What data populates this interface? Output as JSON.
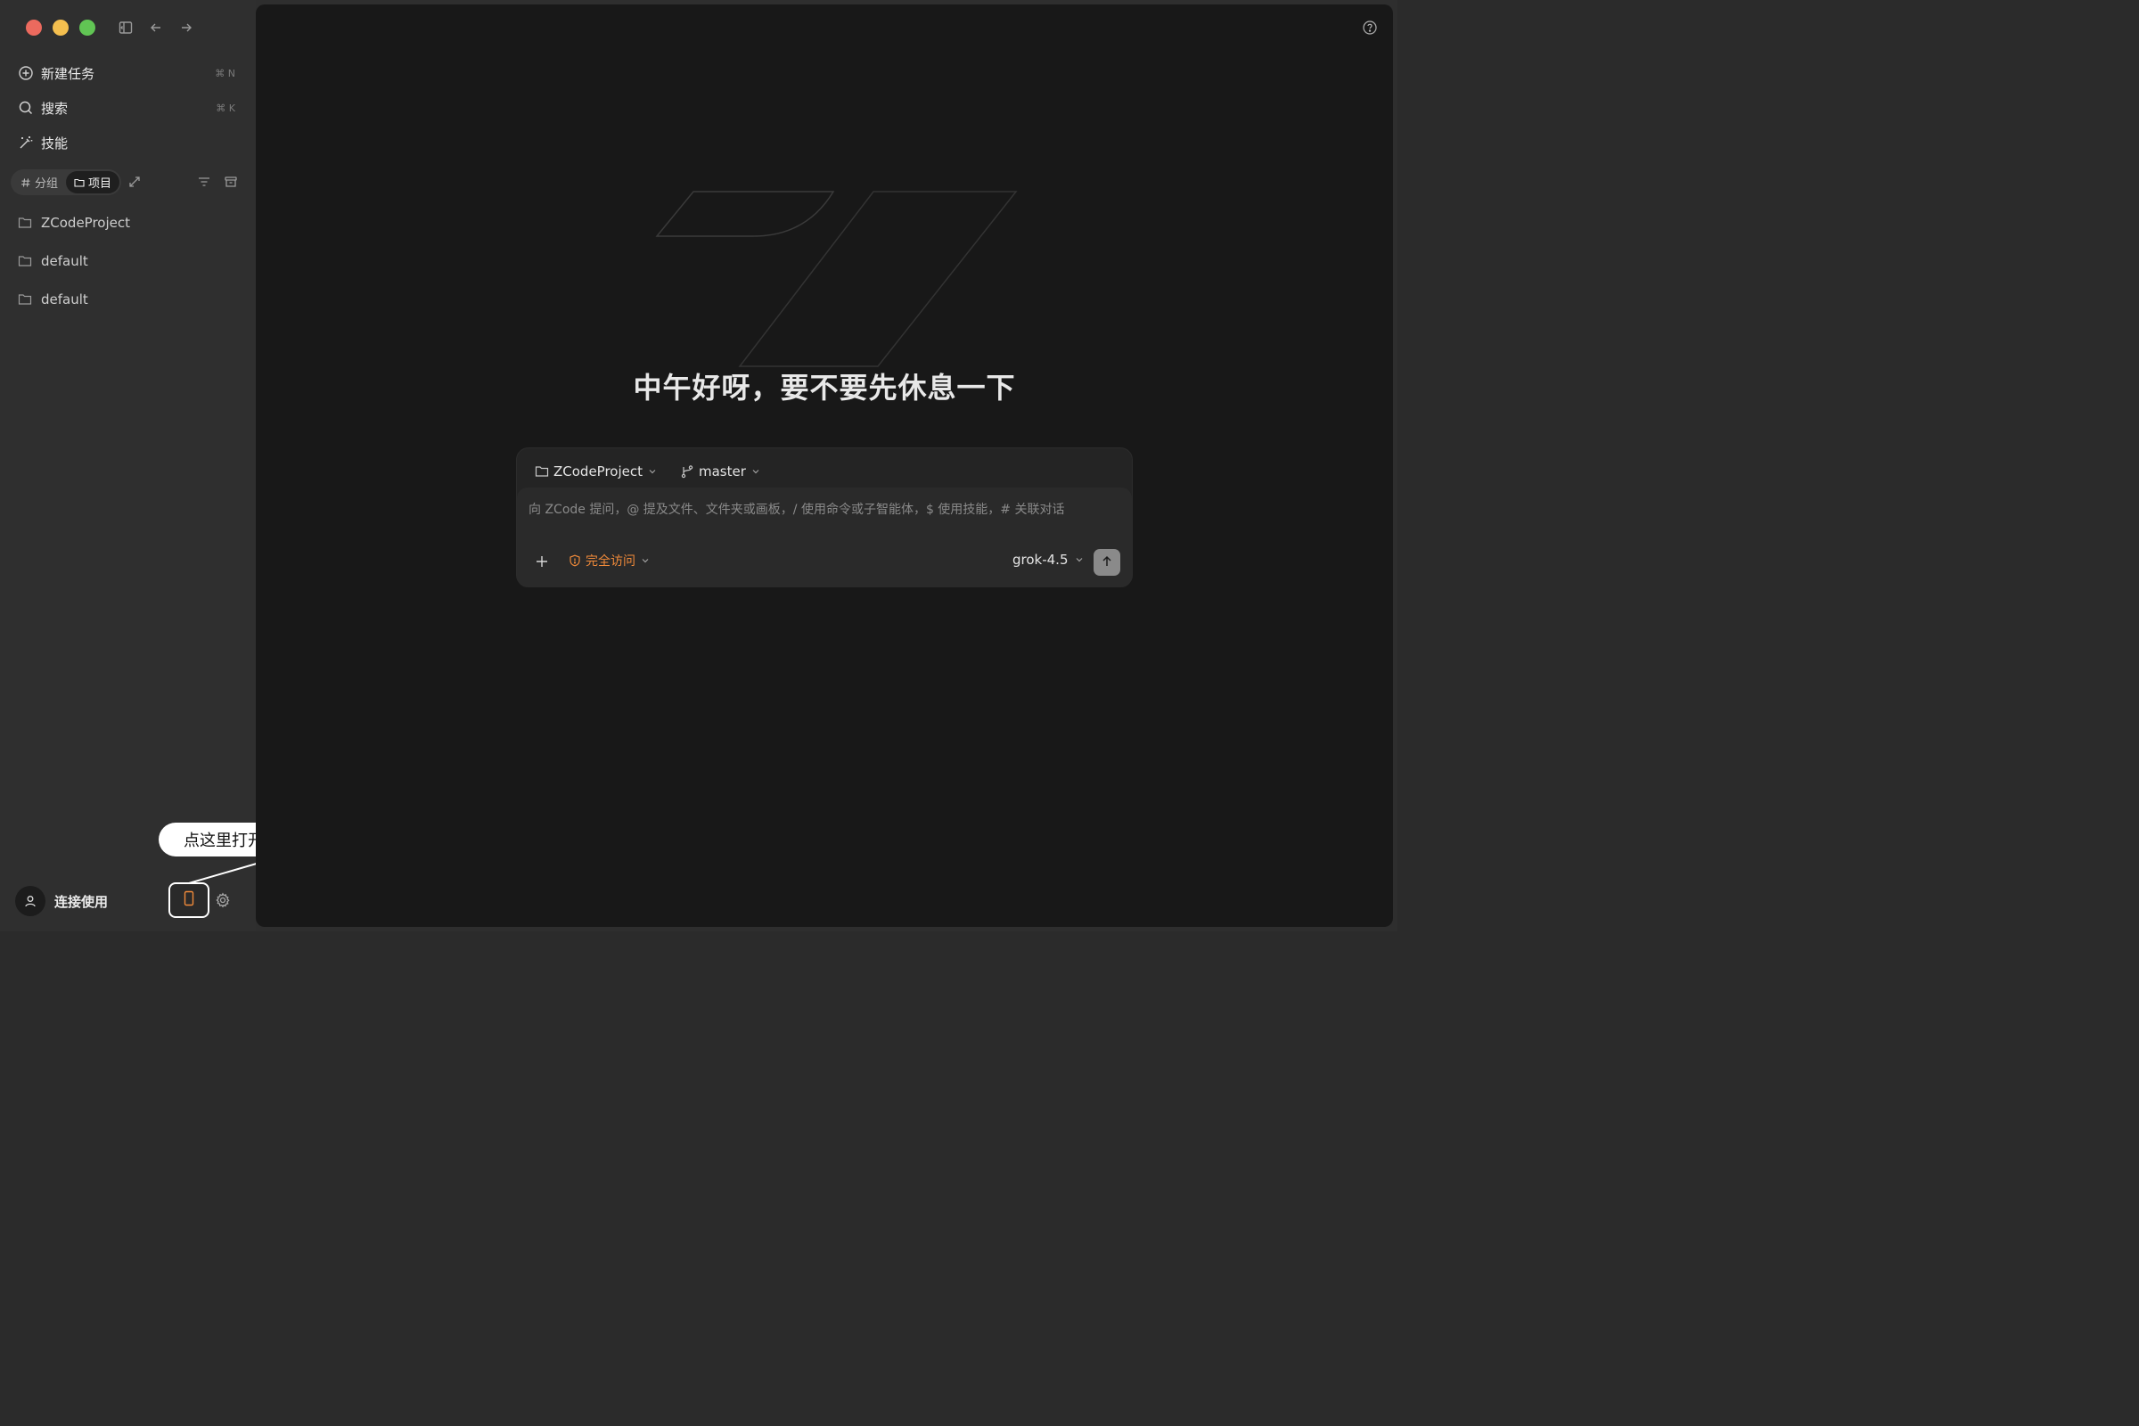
{
  "sidebar": {
    "nav": [
      {
        "label": "新建任务",
        "shortcut": "⌘ N",
        "icon": "plus-circle-icon"
      },
      {
        "label": "搜索",
        "shortcut": "⌘ K",
        "icon": "search-icon"
      },
      {
        "label": "技能",
        "shortcut": "",
        "icon": "magic-wand-icon"
      }
    ],
    "segment": [
      {
        "label": "分组",
        "icon": "hash-icon",
        "active": false
      },
      {
        "label": "项目",
        "icon": "folder-icon",
        "active": true
      }
    ],
    "projects": [
      "ZCodeProject",
      "default",
      "default"
    ],
    "user_label": "连接使用"
  },
  "callout": {
    "text": "点这里打开移动端远程控制"
  },
  "main": {
    "greeting": "中午好呀，要不要先休息一下",
    "composer": {
      "project": "ZCodeProject",
      "branch": "master",
      "placeholder": "向 ZCode 提问，@ 提及文件、文件夹或画板，/ 使用命令或子智能体，$ 使用技能，# 关联对话",
      "access": "完全访问",
      "model": "grok-4.5"
    }
  },
  "colors": {
    "accent": "#f08a3a",
    "background": "#181818",
    "sidebar": "#2f2f2f"
  }
}
